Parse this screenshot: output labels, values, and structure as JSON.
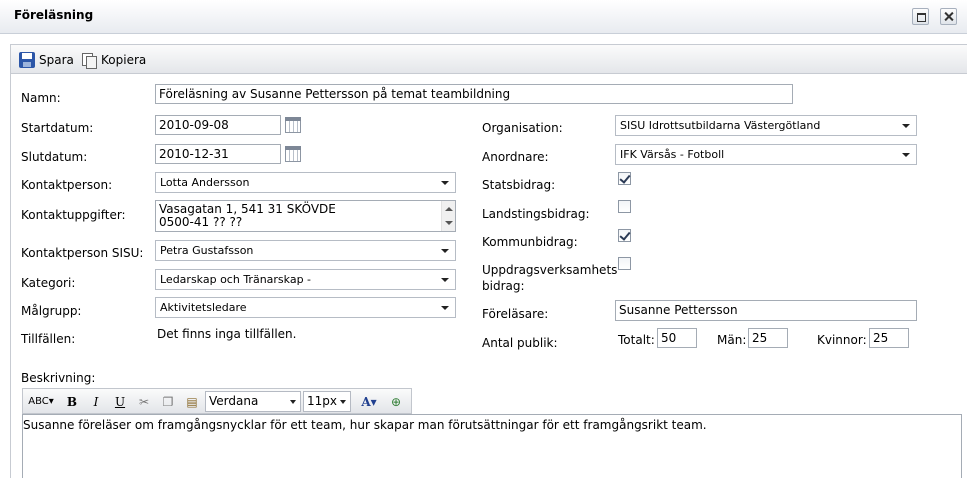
{
  "window": {
    "title": "Föreläsning"
  },
  "toolbar": {
    "save_label": "Spara",
    "copy_label": "Kopiera"
  },
  "form": {
    "namn": {
      "label": "Namn:",
      "value": "Föreläsning av Susanne Pettersson på temat teambildning"
    },
    "startdatum": {
      "label": "Startdatum:",
      "value": "2010-09-08"
    },
    "slutdatum": {
      "label": "Slutdatum:",
      "value": "2010-12-31"
    },
    "kontaktperson": {
      "label": "Kontaktperson:",
      "value": "Lotta Andersson"
    },
    "kontaktuppgifter": {
      "label": "Kontaktuppgifter:",
      "line1": "Vasagatan 1, 541 31 SKÖVDE",
      "line2": "0500-41 ?? ??"
    },
    "kontaktperson_sisu": {
      "label": "Kontaktperson SISU:",
      "value": "Petra Gustafsson"
    },
    "kategori": {
      "label": "Kategori:",
      "value": "Ledarskap och Tränarskap -"
    },
    "malgrupp": {
      "label": "Målgrupp:",
      "value": "Aktivitetsledare"
    },
    "tillfallen": {
      "label": "Tillfällen:",
      "value": "Det finns inga tillfällen."
    },
    "organisation": {
      "label": "Organisation:",
      "value": "SISU Idrottsutbildarna Västergötland"
    },
    "anordnare": {
      "label": "Anordnare:",
      "value": "IFK Värsås - Fotboll"
    },
    "statsbidrag": {
      "label": "Statsbidrag:",
      "checked": true
    },
    "landstingsbidrag": {
      "label": "Landstingsbidrag:",
      "checked": false
    },
    "kommunbidrag": {
      "label": "Kommunbidrag:",
      "checked": true
    },
    "uppdragsverksamhet": {
      "label_line1": "Uppdragsverksamhets",
      "label_line2": "bidrag:",
      "checked": false
    },
    "forelasare": {
      "label": "Föreläsare:",
      "value": "Susanne Pettersson"
    },
    "antal_publik": {
      "label": "Antal publik:",
      "totalt_label": "Totalt:",
      "totalt": "50",
      "man_label": "Män:",
      "man": "25",
      "kvinnor_label": "Kvinnor:",
      "kvinnor": "25"
    },
    "beskrivning": {
      "label": "Beskrivning:",
      "font": "Verdana",
      "size": "11px",
      "text": "Susanne föreläser om framgångsnycklar för ett team, hur skapar man förutsättningar för ett framgångsrikt team."
    }
  },
  "editor_toolbar": {
    "bold": "B",
    "italic": "I",
    "underline": "U",
    "font_color": "A"
  }
}
